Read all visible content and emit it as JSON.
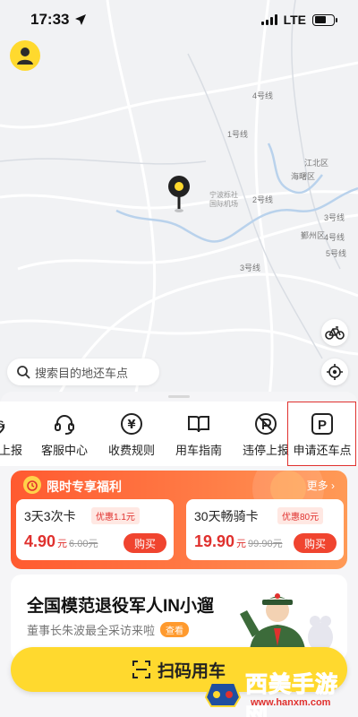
{
  "status_bar": {
    "time": "17:33",
    "network": "LTE"
  },
  "map": {
    "labels": {
      "line4_a": "4号线",
      "line1": "1号线",
      "jiangbei": "江北区",
      "haishu": "海曙区",
      "airport_1": "宁波栎社",
      "airport_2": "国际机场",
      "line2": "2号线",
      "line3_a": "3号线",
      "yinzhou": "鄞州区",
      "line4_b": "4号线",
      "line5": "5号线",
      "line3_b": "3号线"
    }
  },
  "search": {
    "placeholder": "搜索目的地还车点"
  },
  "tools": [
    {
      "label": "上报",
      "icon": "partial-icon"
    },
    {
      "label": "客服中心",
      "icon": "headset-icon"
    },
    {
      "label": "收费规则",
      "icon": "yen-coin-icon"
    },
    {
      "label": "用车指南",
      "icon": "book-icon"
    },
    {
      "label": "违停上报",
      "icon": "no-parking-icon"
    },
    {
      "label": "申请还车点",
      "icon": "parking-icon"
    }
  ],
  "promo": {
    "title": "限时专享福利",
    "more": "更多",
    "cards": [
      {
        "name": "3天3次卡",
        "tag": "优惠1.1元",
        "price": "4.90",
        "unit": "元",
        "old_price": "6.00元",
        "buy": "购买"
      },
      {
        "name": "30天畅骑卡",
        "tag": "优惠80元",
        "price": "19.90",
        "unit": "元",
        "old_price": "99.90元",
        "buy": "购买"
      }
    ]
  },
  "news": {
    "headline": "全国模范退役军人IN小遛",
    "subtitle": "董事长朱波最全采访来啦",
    "view_label": "查看"
  },
  "scan_button": {
    "label": "扫码用车"
  },
  "watermark": {
    "text": "西美手游网",
    "url": "www.hanxm.com"
  },
  "colors": {
    "accent_yellow": "#ffd92e",
    "promo_orange": "#ff5a30",
    "price_red": "#e0312e",
    "highlight_red": "#e0312e"
  }
}
